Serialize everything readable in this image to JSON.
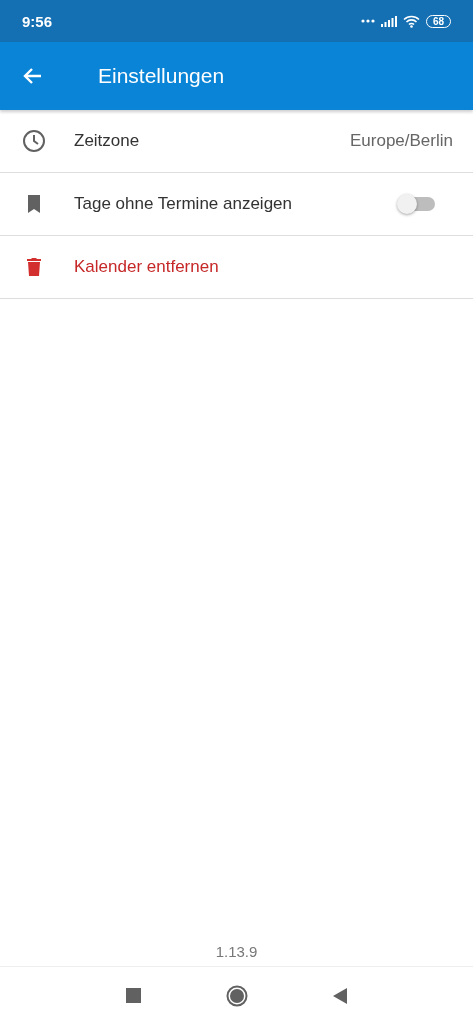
{
  "status_bar": {
    "time": "9:56",
    "battery": "68"
  },
  "app_bar": {
    "title": "Einstellungen"
  },
  "settings": [
    {
      "kind": "value",
      "label": "Zeitzone",
      "value": "Europe/Berlin"
    },
    {
      "kind": "toggle",
      "label": "Tage ohne Termine anzeigen",
      "on": false
    },
    {
      "kind": "action",
      "label": "Kalender entfernen"
    }
  ],
  "version": "1.13.9"
}
